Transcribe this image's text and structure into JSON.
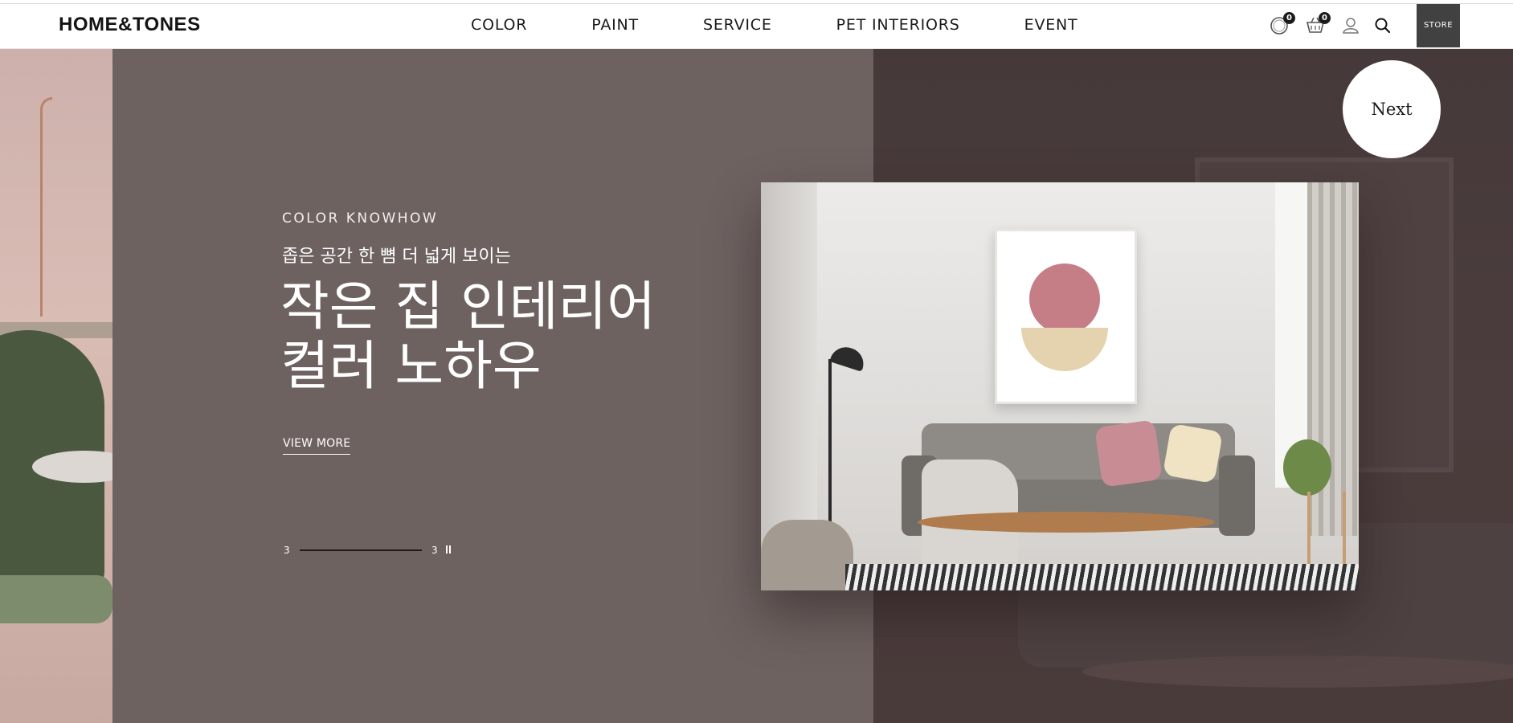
{
  "header": {
    "logo": "HOME&TONES",
    "nav": [
      "COLOR",
      "PAINT",
      "SERVICE",
      "PET INTERIORS",
      "EVENT"
    ],
    "icons": {
      "recent": {
        "name": "recent-view-icon",
        "count": "0"
      },
      "cart": {
        "name": "cart-icon",
        "count": "0"
      },
      "user": {
        "name": "user-icon"
      },
      "search": {
        "name": "search-icon"
      }
    },
    "store_label": "STORE"
  },
  "hero": {
    "eyebrow": "COLOR KNOWHOW",
    "subtitle": "좁은 공간 한 뼘 더 넓게 보이는",
    "headline_line1": "작은 집 인테리어",
    "headline_line2": "컬러 노하우",
    "cta": "VIEW MORE",
    "pager": {
      "current": "3",
      "total": "3",
      "progress": 1.0
    },
    "next_label": "Next"
  },
  "colors": {
    "panel": "#6e6261",
    "right_photo": "#46393a",
    "header_bg": "#ffffff",
    "store_bg": "#414141"
  }
}
